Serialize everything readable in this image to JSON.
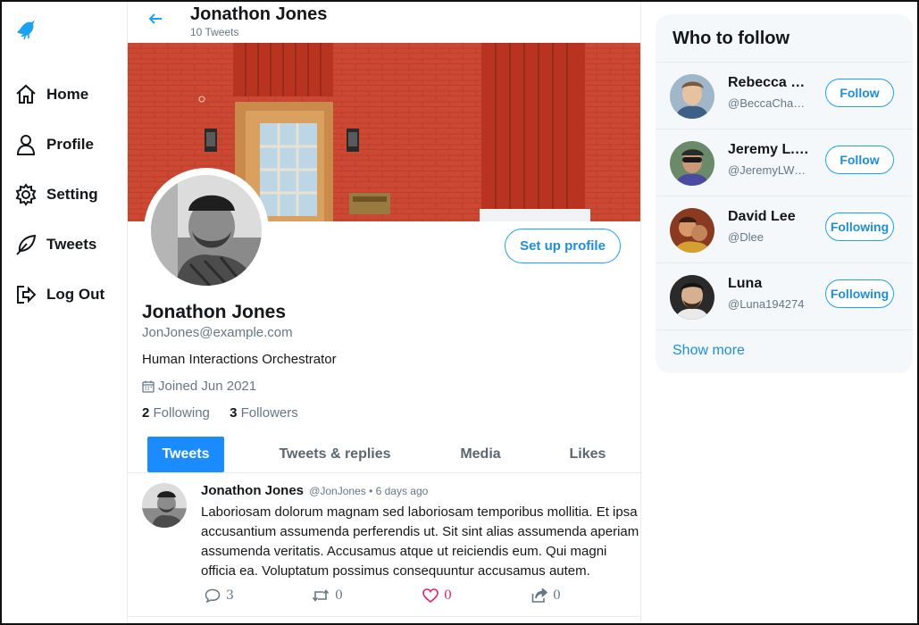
{
  "nav": {
    "items": [
      {
        "label": "Home",
        "icon": "home-icon"
      },
      {
        "label": "Profile",
        "icon": "user-icon"
      },
      {
        "label": "Setting",
        "icon": "gear-icon"
      },
      {
        "label": "Tweets",
        "icon": "feather-icon"
      },
      {
        "label": "Log Out",
        "icon": "logout-icon"
      }
    ]
  },
  "header": {
    "name": "Jonathon Jones",
    "tweet_count": "10 Tweets"
  },
  "profile": {
    "name": "Jonathon Jones",
    "email": "JonJones@example.com",
    "bio": "Human Interactions Orchestrator",
    "joined": "Joined Jun 2021",
    "following_count": "2",
    "following_label": "Following",
    "followers_count": "3",
    "followers_label": "Followers",
    "setup_label": "Set up profile"
  },
  "tabs": [
    {
      "label": "Tweets",
      "active": true
    },
    {
      "label": "Tweets & replies",
      "active": false
    },
    {
      "label": "Media",
      "active": false
    },
    {
      "label": "Likes",
      "active": false
    }
  ],
  "tweet": {
    "author": "Jonathon Jones",
    "meta": "@JonJones • 6 days ago",
    "body": "Laboriosam dolorum magnam sed laboriosam temporibus mollitia. Et ipsa accusantium assumenda perferendis ut. Sit sint alias assumenda aperiam assumenda veritatis. Accusamus atque ut reiciendis eum. Qui magni officia ea. Voluptatum possimus consequuntur accusamus autem.",
    "replies": "3",
    "retweets": "0",
    "likes": "0",
    "shares": "0"
  },
  "who_to_follow": {
    "title": "Who to follow",
    "users": [
      {
        "name": "Rebecca …",
        "handle": "@BeccaCha…",
        "button": "Follow"
      },
      {
        "name": "Jeremy L.…",
        "handle": "@JeremyLWong",
        "button": "Follow"
      },
      {
        "name": "David Lee",
        "handle": "@Dlee",
        "button": "Following"
      },
      {
        "name": "Luna",
        "handle": "@Luna194274",
        "button": "Following"
      }
    ],
    "show_more": "Show more"
  },
  "colors": {
    "accent": "#1da1f2",
    "tab_active": "#1a8cff",
    "like": "#e0245e",
    "banner": "#c5402d"
  }
}
